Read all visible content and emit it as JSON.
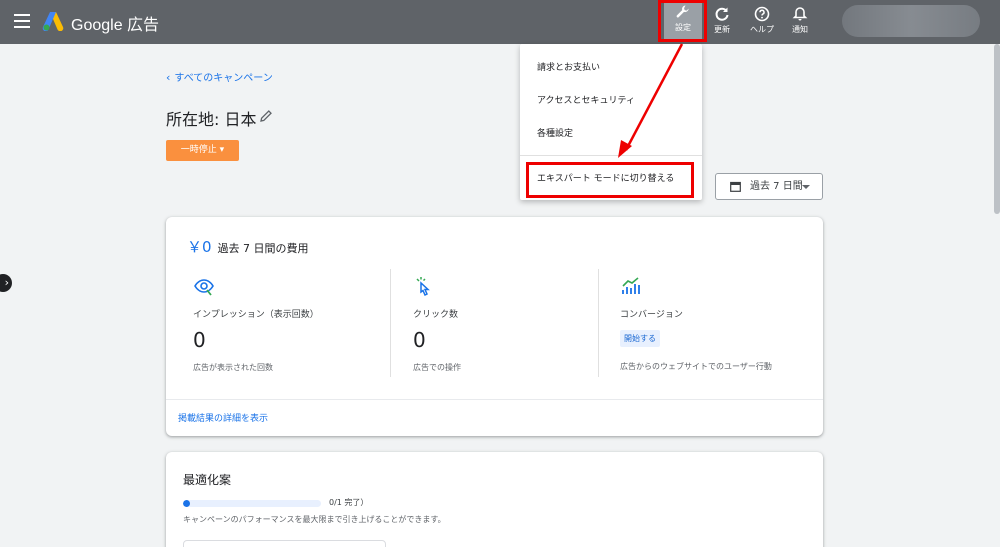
{
  "topbar": {
    "brand": "Google 広告",
    "tools": {
      "settings": "設定",
      "refresh": "更新",
      "help": "ヘルプ",
      "notifications": "通知"
    }
  },
  "header": {
    "back_link": "すべてのキャンペーン",
    "page_title": "所在地: 日本",
    "pause_button": "一時停止",
    "date_range": "過去 7 日間"
  },
  "summary": {
    "cost_amount": "￥0",
    "cost_label": "過去 7 日間の費用",
    "metrics": [
      {
        "name": "インプレッション（表示回数）",
        "value": "0",
        "desc": "広告が表示された回数"
      },
      {
        "name": "クリック数",
        "value": "0",
        "desc": "広告での操作"
      },
      {
        "name": "コンバージョン",
        "badge": "開始する",
        "desc": "広告からのウェブサイトでのユーザー行動"
      }
    ],
    "details_link": "掲載結果の詳細を表示"
  },
  "optimization": {
    "title": "最適化案",
    "progress": 0.05,
    "count": "0/1 完了）",
    "desc": "キャンペーンのパフォーマンスを最大限まで引き上げることができます。"
  },
  "dropdown": {
    "items": [
      "請求とお支払い",
      "アクセスとセキュリティ",
      "各種設定",
      "エキスパート モードに切り替える"
    ]
  },
  "colors": {
    "topbar": "#5f6368",
    "accent": "#1a73e8",
    "pause": "#fa903e",
    "highlight": "#e00000"
  }
}
